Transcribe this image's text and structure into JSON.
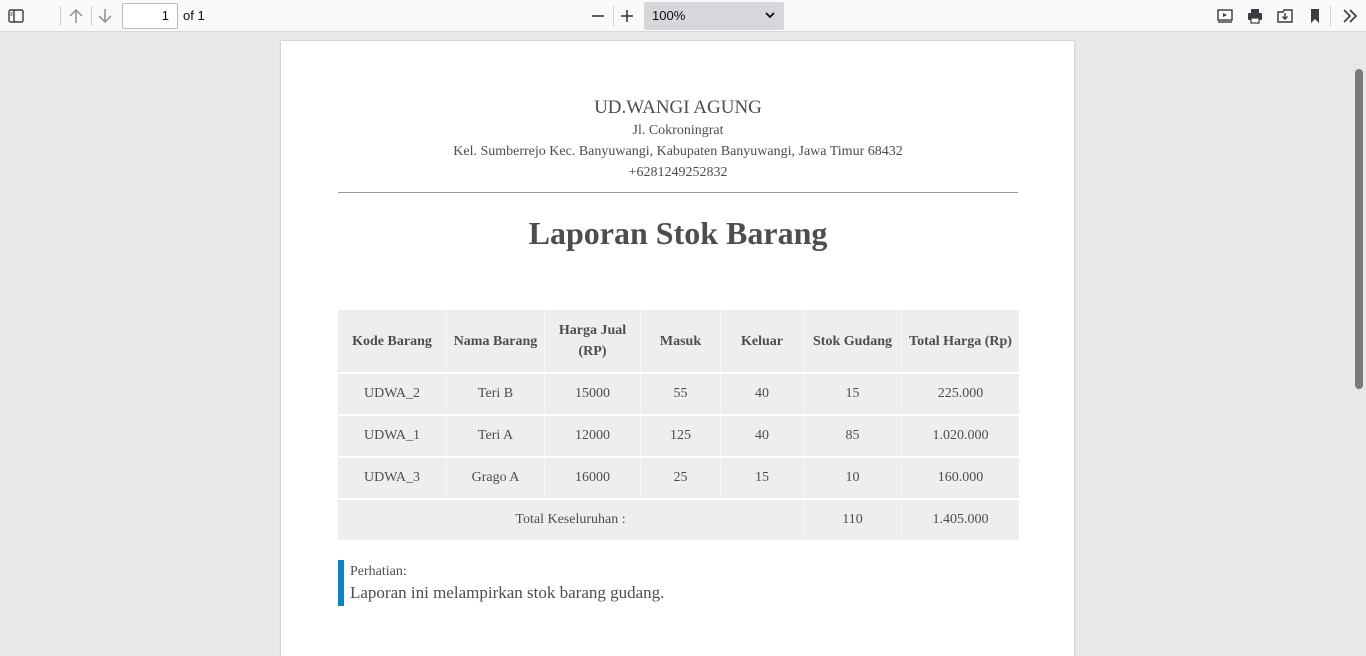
{
  "toolbar": {
    "icons": {
      "sidebar": "sidebar-toggle-icon",
      "prev": "arrow-up-icon",
      "next": "arrow-down-icon",
      "zoom_out": "minus-icon",
      "zoom_in": "plus-icon",
      "presentation": "presentation-icon",
      "print": "print-icon",
      "save": "save-icon",
      "bookmark": "bookmark-icon",
      "tools": "double-chevron-right-icon"
    },
    "page_number": "1",
    "page_total": "of 1",
    "zoom": "100%"
  },
  "document": {
    "company": "UD.WANGI AGUNG",
    "address_line1": "Jl. Cokroningrat",
    "address_line2": "Kel. Sumberrejo Kec. Banyuwangi, Kabupaten Banyuwangi, Jawa Timur 68432",
    "phone": "+6281249252832",
    "title": "Laporan Stok Barang",
    "table": {
      "headers": {
        "kode": "Kode Barang",
        "nama": "Nama Barang",
        "harga": "Harga Jual (RP)",
        "masuk": "Masuk",
        "keluar": "Keluar",
        "stok": "Stok Gudang",
        "total": "Total Harga (Rp)"
      },
      "rows": [
        {
          "kode": "UDWA_2",
          "nama": "Teri B",
          "harga": "15000",
          "masuk": "55",
          "keluar": "40",
          "stok": "15",
          "total": "225.000"
        },
        {
          "kode": "UDWA_1",
          "nama": "Teri A",
          "harga": "12000",
          "masuk": "125",
          "keluar": "40",
          "stok": "85",
          "total": "1.020.000"
        },
        {
          "kode": "UDWA_3",
          "nama": "Grago A",
          "harga": "16000",
          "masuk": "25",
          "keluar": "15",
          "stok": "10",
          "total": "160.000"
        }
      ],
      "summary": {
        "label": "Total Keseluruhan :",
        "stok": "110",
        "total": "1.405.000"
      }
    },
    "note": {
      "label": "Perhatian:",
      "text": "Laporan ini melampirkan stok barang gudang."
    }
  },
  "colors": {
    "note_accent": "#0a84c6",
    "table_bg": "#eeeeee",
    "text": "#4d4d4d"
  }
}
